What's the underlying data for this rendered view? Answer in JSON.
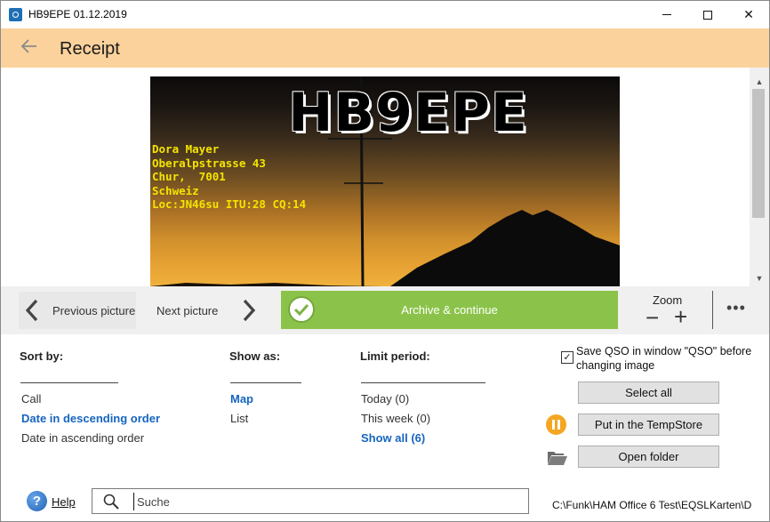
{
  "window": {
    "title": "HB9EPE 01.12.2019",
    "minimize_glyph": "—",
    "maximize_glyph": "☐",
    "close_glyph": "✕"
  },
  "header": {
    "back_icon": "arrow-left-icon",
    "title": "Receipt",
    "background_color": "#fbd29c"
  },
  "card": {
    "callsign": "HB9EPE",
    "address_lines": [
      "Dora Mayer",
      "Oberalpstrasse 43",
      "Chur,  7001",
      "Schweiz",
      "Loc:JN46su ITU:28 CQ:14"
    ],
    "address_color": "#f4e400"
  },
  "nav": {
    "previous_label": "Previous picture",
    "next_label": "Next picture",
    "archive_label": "Archive & continue",
    "archive_color": "#8bc34a",
    "zoom_label": "Zoom",
    "zoom_minus": "−",
    "zoom_plus": "+",
    "more_label": "•••"
  },
  "sort": {
    "heading": "Sort by:",
    "options": [
      "Call",
      "Date in descending order",
      "Date in ascending order"
    ],
    "selected_index": 1
  },
  "show_as": {
    "heading": "Show as:",
    "options": [
      "Map",
      "List"
    ],
    "selected_index": 0
  },
  "limit": {
    "heading": "Limit period:",
    "options": [
      "Today (0)",
      "This week (0)",
      "Show all (6)"
    ],
    "selected_index": 2
  },
  "actions": {
    "save_qso_label": "Save QSO in window \"QSO\" before changing image",
    "save_qso_checked": true,
    "select_all_label": "Select all",
    "tempstore_label": "Put in the TempStore",
    "open_folder_label": "Open folder",
    "accent_color": "#f5a623"
  },
  "footer": {
    "help_label": "Help",
    "search_placeholder": "Suche",
    "path": "C:\\Funk\\HAM Office 6 Test\\EQSLKarten\\D"
  }
}
